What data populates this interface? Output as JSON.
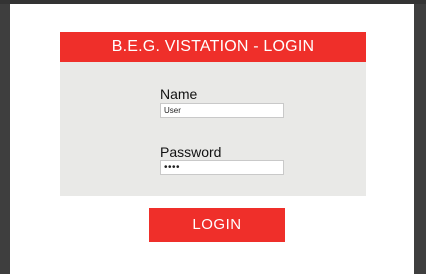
{
  "login": {
    "title": "B.E.G. VISTATION - LOGIN",
    "name_label": "Name",
    "name_value": "User",
    "password_label": "Password",
    "password_value": "••••",
    "button_label": "LOGIN"
  },
  "colors": {
    "accent": "#ef2f2a",
    "card_background": "#e9e9e7",
    "page_background": "#ffffff",
    "frame_background": "#3e3e3e"
  }
}
